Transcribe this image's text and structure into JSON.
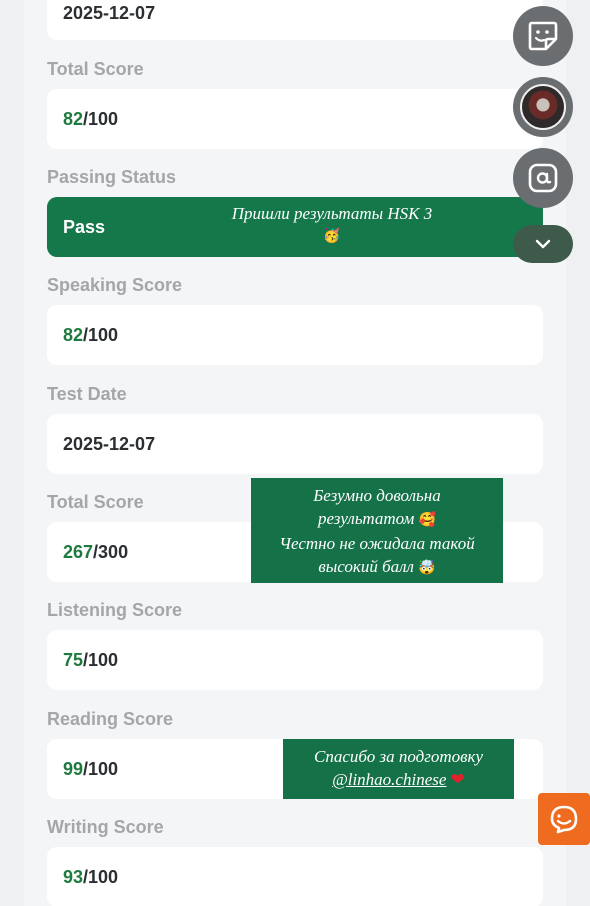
{
  "fields": [
    {
      "id": "date_top",
      "label": "",
      "value": "2025-12-07"
    },
    {
      "id": "total_score_1",
      "label": "Total Score",
      "score": "82",
      "max": "/100"
    },
    {
      "id": "passing_status",
      "label": "Passing Status",
      "value": "Pass"
    },
    {
      "id": "speaking_score",
      "label": "Speaking Score",
      "score": "82",
      "max": "/100"
    },
    {
      "id": "test_date",
      "label": "Test Date",
      "value": "2025-12-07"
    },
    {
      "id": "total_score_2",
      "label": "Total Score",
      "score": "267",
      "max": "/300"
    },
    {
      "id": "listening_score",
      "label": "Listening Score",
      "score": "75",
      "max": "/100"
    },
    {
      "id": "reading_score",
      "label": "Reading Score",
      "score": "99",
      "max": "/100"
    },
    {
      "id": "writing_score",
      "label": "Writing Score",
      "score": "93",
      "max": "/100"
    }
  ],
  "overlays": {
    "o1": {
      "line1": "Пришли результаты HSK 3",
      "emoji1": "🥳"
    },
    "o2": {
      "line1": "Безумно довольна",
      "line2": "результатом",
      "emoji2": "🥰",
      "line3": "Честно не ожидала такой",
      "line4": "высокий балл",
      "emoji4": "🤯"
    },
    "o3": {
      "line1": "Спасибо за подготовку",
      "mention": "@linhao.chinese",
      "heart": "❤"
    }
  },
  "icons": {
    "sticker": "sticker-icon",
    "avatar": "profile-avatar",
    "mention": "at-sign-icon",
    "chevron": "chevron-down-icon",
    "help": "support-chat-icon"
  },
  "colors": {
    "accent_green": "#15784a",
    "score_green": "#1e7a3f",
    "label_gray": "#a3a7aa",
    "help_orange": "#ef6b1f"
  }
}
